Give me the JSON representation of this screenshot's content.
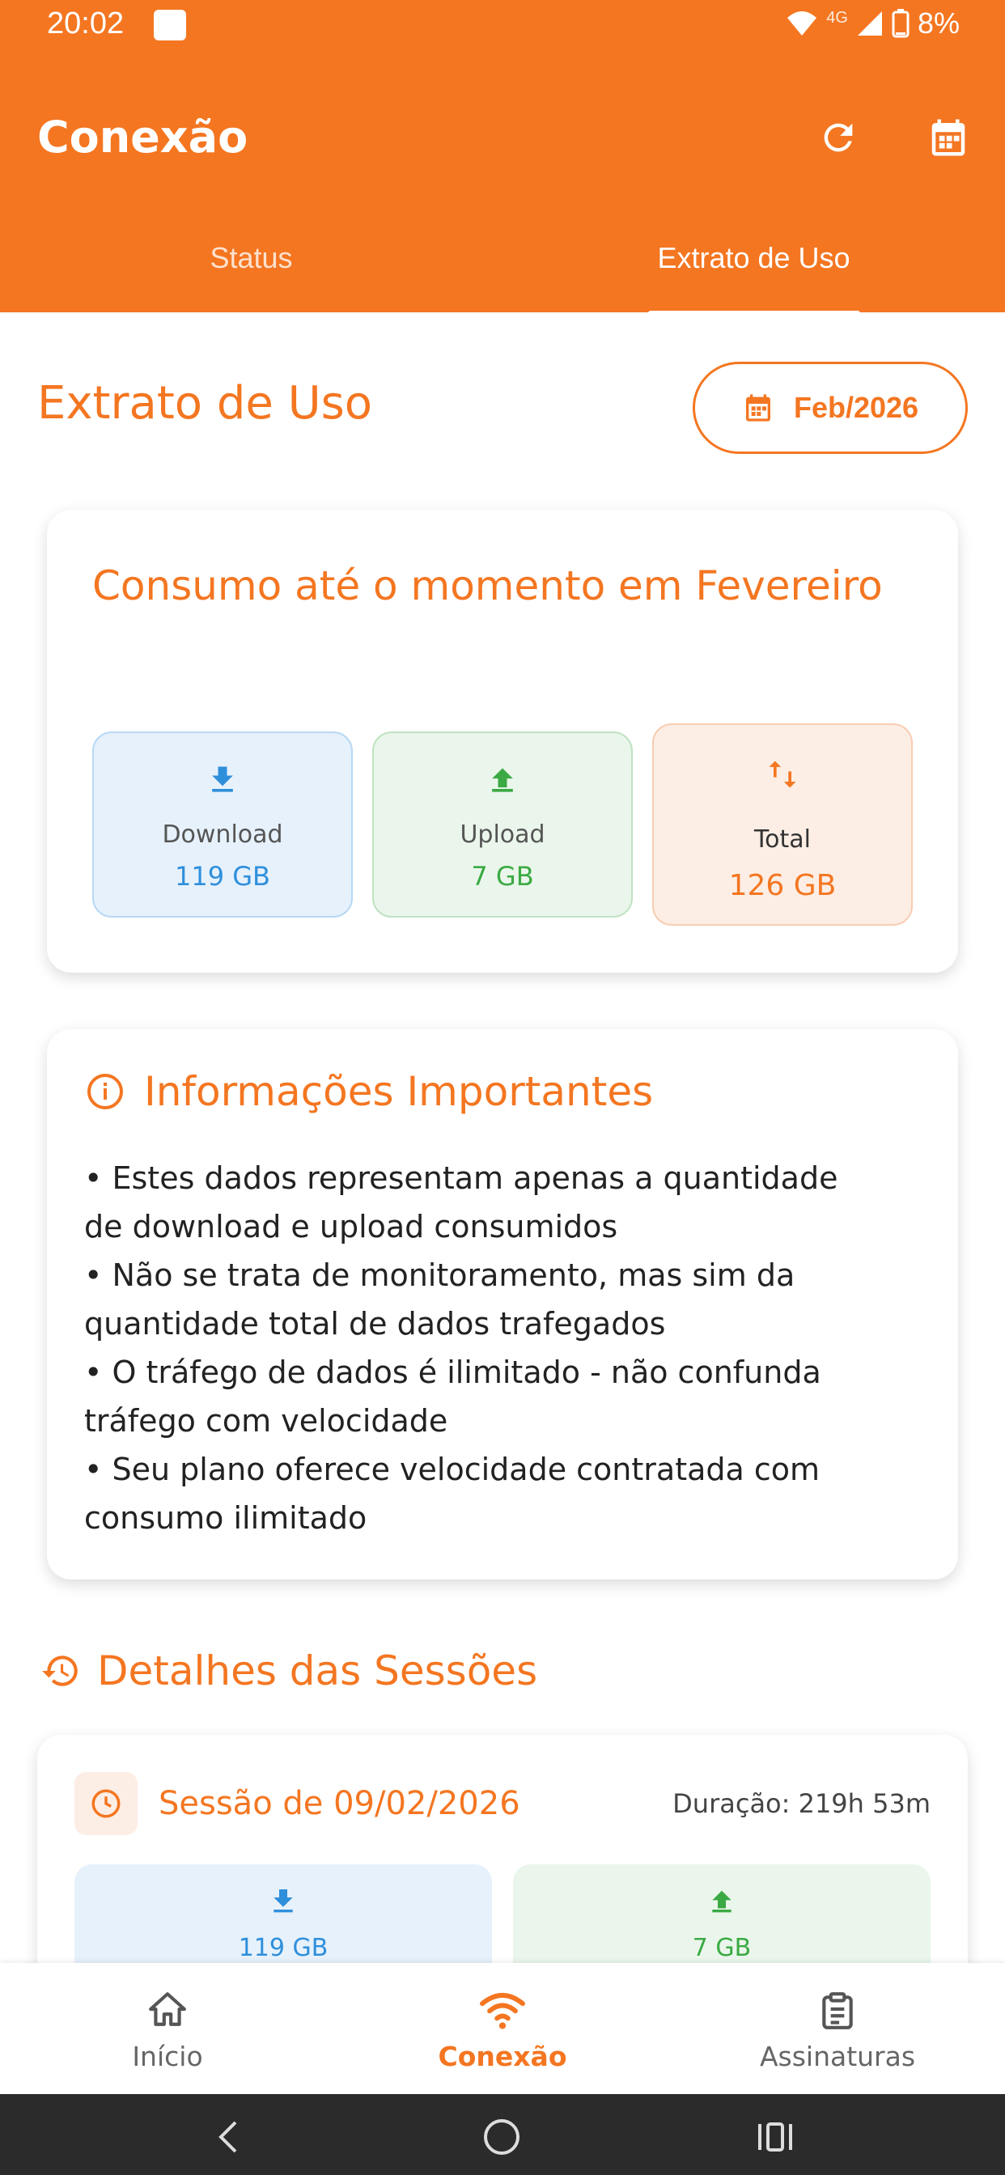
{
  "status_bar": {
    "time": "20:02",
    "network": "4G",
    "battery": "8%"
  },
  "header": {
    "title": "Conexão",
    "tabs": [
      {
        "label": "Status"
      },
      {
        "label": "Extrato de Uso"
      }
    ]
  },
  "page": {
    "heading": "Extrato de Uso",
    "month_button": "Feb/2026"
  },
  "consumo": {
    "title": "Consumo até o momento em Fevereiro",
    "download": {
      "label": "Download",
      "value": "119 GB"
    },
    "upload": {
      "label": "Upload",
      "value": "7 GB"
    },
    "total": {
      "label": "Total",
      "value": "126 GB"
    }
  },
  "info": {
    "title": "Informações Importantes",
    "lines": [
      "• Estes dados representam apenas a quantidade",
      "de download e upload consumidos",
      "• Não se trata de monitoramento, mas sim da",
      "quantidade total de dados trafegados",
      "• O tráfego de dados é ilimitado - não confunda",
      "tráfego com velocidade",
      "• Seu plano oferece velocidade contratada com",
      "consumo ilimitado"
    ]
  },
  "sessions": {
    "title": "Detalhes das Sessões",
    "items": [
      {
        "date": "Sessão de 09/02/2026",
        "duration": "Duração: 219h 53m",
        "download": "119 GB",
        "upload": "7 GB"
      }
    ]
  },
  "bottom_nav": {
    "items": [
      {
        "label": "Início"
      },
      {
        "label": "Conexão"
      },
      {
        "label": "Assinaturas"
      }
    ]
  },
  "colors": {
    "primary": "#F47621",
    "download": "#2F8FDB",
    "upload": "#3BAA44"
  }
}
